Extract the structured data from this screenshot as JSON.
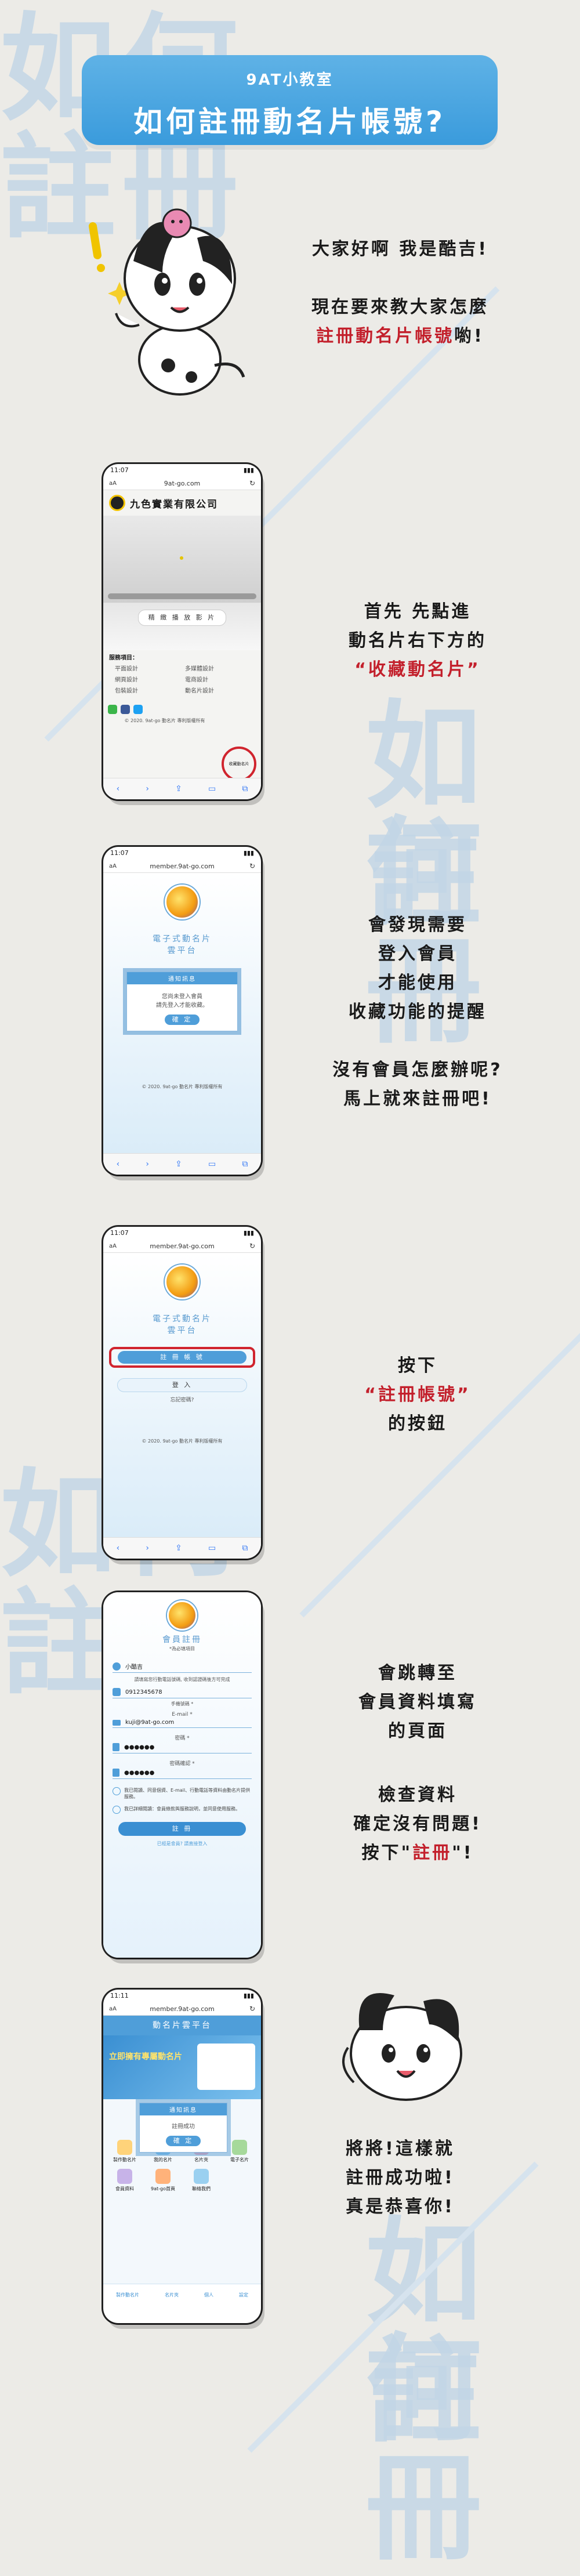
{
  "banner": {
    "subtitle": "9AT小教室",
    "title": "如何註冊動名片帳號?"
  },
  "watermark": {
    "line1": "如何",
    "line2": "註冊"
  },
  "intro": {
    "line1": "大家好啊 我是酷吉!",
    "line2": "現在要來教大家怎麼",
    "line3_highlight": "註冊動名片帳號",
    "line3_rest": "喲!"
  },
  "step1": {
    "line1": "首先 先點進",
    "line2": "動名片右下方的",
    "line3": "“收藏動名片”",
    "phone": {
      "time": "11:07",
      "url": "9at-go.com",
      "company": "九色實業有限公司",
      "video_button": "精 緻 播 放 影 片",
      "section_label": "服務項目：",
      "services": [
        "平面設計",
        "多媒體設計",
        "網頁設計",
        "電商設計",
        "包裝設計",
        "動名片設計"
      ],
      "footer": "© 2020. 9at-go 動名片 專利版權所有",
      "collect_label": "收藏動名片"
    }
  },
  "step2": {
    "line1": "會發現需要",
    "line2": "登入會員",
    "line3": "才能使用",
    "line4": "收藏功能的提醒",
    "line5": "沒有會員怎麼辦呢?",
    "line6": "馬上就來註冊吧!",
    "phone": {
      "time": "11:07",
      "url": "member.9at-go.com",
      "platform_line1": "電子式動名片",
      "platform_line2": "雲平台",
      "dialog_title": "通知訊息",
      "dialog_line1": "您尚未登入會員",
      "dialog_line2": "請先登入才能收藏。",
      "dialog_ok": "確 定",
      "footer": "© 2020. 9at-go 動名片 專利版權所有"
    }
  },
  "step3": {
    "line1": "按下",
    "line2": "“註冊帳號”",
    "line3": "的按鈕",
    "phone": {
      "time": "11:07",
      "url": "member.9at-go.com",
      "platform_line1": "電子式動名片",
      "platform_line2": "雲平台",
      "register_button": "註 冊 帳 號",
      "login_button": "登 入",
      "forgot": "忘記密碼?",
      "footer": "© 2020. 9at-go 動名片 專利版權所有"
    }
  },
  "step4": {
    "line1": "會跳轉至",
    "line2": "會員資料填寫",
    "line3": "的頁面",
    "line4": "檢查資料",
    "line5": "確定沒有問題!",
    "line6_pre": "按下\"",
    "line6_red": "註冊",
    "line6_post": "\"!",
    "phone": {
      "title": "會員註冊",
      "subtitle": "*為必填項目",
      "name_value": "小酷吉",
      "phone_note": "請填寫您行動電話號碼, 收到認證碼後方可完成",
      "phone_value": "0912345678",
      "phone_hint": "手機號碼 *",
      "email_label": "E-mail *",
      "email_value": "kuji@9at-go.com",
      "password_label": "密碼 *",
      "password_value": "●●●●●●",
      "confirm_label": "密碼確認 *",
      "confirm_value": "●●●●●●",
      "agree1": "我已閱讀、同意個資、E-mail、行動電話等資料由動名片提供服務。",
      "agree2": "我已詳細閱讀：會員條款與服務說明，並同意使用服務。",
      "submit": "註 冊",
      "footer": "已經是會員? 請直接登入"
    }
  },
  "step5": {
    "line1": "將將!這樣就",
    "line2": "註冊成功啦!",
    "line3": "真是恭喜你!",
    "phone": {
      "time": "11:11",
      "url": "member.9at-go.com",
      "header": "動名片雲平台",
      "dialog_title": "通知訊息",
      "dialog_msg": "註冊成功",
      "dialog_ok": "確 定",
      "promo": "立即擁有專屬動名片",
      "menu": [
        "製作動名片",
        "我的名片",
        "名片夾",
        "電子名片",
        "會員資料",
        "9at-go首頁",
        "聯絡我們"
      ],
      "tabs": [
        "製作動名片",
        "名片夾",
        "個人",
        "設定"
      ]
    }
  },
  "colors": {
    "accent": "#3a9bdc",
    "highlight_red": "#c3202c",
    "watermark": "#c3d6e6"
  }
}
